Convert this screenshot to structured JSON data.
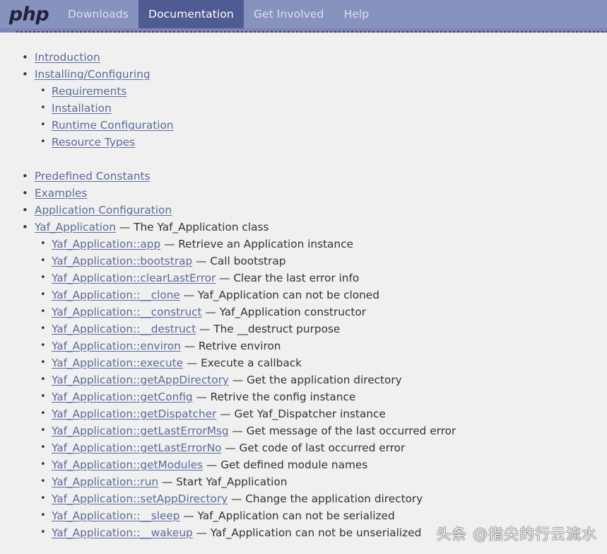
{
  "nav": {
    "logo_text": "php",
    "items": [
      {
        "label": "Downloads",
        "active": false
      },
      {
        "label": "Documentation",
        "active": true
      },
      {
        "label": "Get Involved",
        "active": false
      },
      {
        "label": "Help",
        "active": false
      }
    ],
    "colors": {
      "bar_background": "#8892bf",
      "bar_shadow": "#7b86b8",
      "active_tab": "#4f5b93",
      "label": "#dcdfeb",
      "active_label": "#ffffff",
      "logo": "#21223c",
      "dotted_rule": "#6d2b3a"
    }
  },
  "page": {
    "background": "#f0f0f0",
    "text_color": "#333333",
    "link_color": "#5c6a9c",
    "dash": "—"
  },
  "toc": {
    "group1": [
      {
        "link": "Introduction",
        "desc": "",
        "children": []
      },
      {
        "link": "Installing/Configuring",
        "desc": "",
        "children": [
          {
            "link": "Requirements",
            "desc": ""
          },
          {
            "link": "Installation",
            "desc": ""
          },
          {
            "link": "Runtime Configuration",
            "desc": ""
          },
          {
            "link": "Resource Types",
            "desc": ""
          }
        ]
      }
    ],
    "group2": [
      {
        "link": "Predefined Constants",
        "desc": "",
        "children": []
      },
      {
        "link": "Examples",
        "desc": "",
        "children": []
      },
      {
        "link": "Application Configuration",
        "desc": "",
        "children": []
      },
      {
        "link": "Yaf_Application",
        "desc": "The Yaf_Application class",
        "children": [
          {
            "link": "Yaf_Application::app",
            "desc": "Retrieve an Application instance"
          },
          {
            "link": "Yaf_Application::bootstrap",
            "desc": "Call bootstrap"
          },
          {
            "link": "Yaf_Application::clearLastError",
            "desc": "Clear the last error info"
          },
          {
            "link": "Yaf_Application::__clone",
            "desc": "Yaf_Application can not be cloned"
          },
          {
            "link": "Yaf_Application::__construct",
            "desc": "Yaf_Application constructor"
          },
          {
            "link": "Yaf_Application::__destruct",
            "desc": "The __destruct purpose"
          },
          {
            "link": "Yaf_Application::environ",
            "desc": "Retrive environ"
          },
          {
            "link": "Yaf_Application::execute",
            "desc": "Execute a callback"
          },
          {
            "link": "Yaf_Application::getAppDirectory",
            "desc": "Get the application directory"
          },
          {
            "link": "Yaf_Application::getConfig",
            "desc": "Retrive the config instance"
          },
          {
            "link": "Yaf_Application::getDispatcher",
            "desc": "Get Yaf_Dispatcher instance"
          },
          {
            "link": "Yaf_Application::getLastErrorMsg",
            "desc": "Get message of the last occurred error"
          },
          {
            "link": "Yaf_Application::getLastErrorNo",
            "desc": "Get code of last occurred error"
          },
          {
            "link": "Yaf_Application::getModules",
            "desc": "Get defined module names"
          },
          {
            "link": "Yaf_Application::run",
            "desc": "Start Yaf_Application"
          },
          {
            "link": "Yaf_Application::setAppDirectory",
            "desc": "Change the application directory"
          },
          {
            "link": "Yaf_Application::__sleep",
            "desc": "Yaf_Application can not be serialized"
          },
          {
            "link": "Yaf_Application::__wakeup",
            "desc": "Yaf_Application can not be unserialized"
          }
        ]
      }
    ]
  },
  "watermark": {
    "text": "头条 @指尖的行云流水"
  }
}
